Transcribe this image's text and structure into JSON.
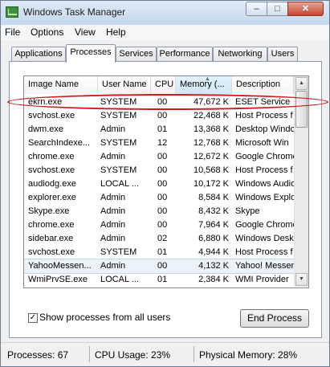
{
  "window": {
    "title": "Windows Task Manager",
    "min": "–",
    "max": "□",
    "close": "✕"
  },
  "menu": [
    {
      "label": "File"
    },
    {
      "label": "Options"
    },
    {
      "label": "View"
    },
    {
      "label": "Help"
    }
  ],
  "tabs": [
    {
      "label": "Applications"
    },
    {
      "label": "Processes"
    },
    {
      "label": "Services"
    },
    {
      "label": "Performance"
    },
    {
      "label": "Networking"
    },
    {
      "label": "Users"
    }
  ],
  "active_tab": "Processes",
  "columns": {
    "name": "Image Name",
    "user": "User Name",
    "cpu": "CPU",
    "memory": "Memory (...",
    "description": "Description",
    "sorted_indicator": "▲"
  },
  "processes": [
    {
      "name": "ekrn.exe",
      "user": "SYSTEM",
      "cpu": "00",
      "mem": "47,672 K",
      "desc": "ESET Service"
    },
    {
      "name": "svchost.exe",
      "user": "SYSTEM",
      "cpu": "00",
      "mem": "22,468 K",
      "desc": "Host Process f"
    },
    {
      "name": "dwm.exe",
      "user": "Admin",
      "cpu": "01",
      "mem": "13,368 K",
      "desc": "Desktop Windo"
    },
    {
      "name": "SearchIndexe...",
      "user": "SYSTEM",
      "cpu": "12",
      "mem": "12,768 K",
      "desc": "Microsoft Win"
    },
    {
      "name": "chrome.exe",
      "user": "Admin",
      "cpu": "00",
      "mem": "12,672 K",
      "desc": "Google Chrome"
    },
    {
      "name": "svchost.exe",
      "user": "SYSTEM",
      "cpu": "00",
      "mem": "10,568 K",
      "desc": "Host Process f"
    },
    {
      "name": "audiodg.exe",
      "user": "LOCAL ...",
      "cpu": "00",
      "mem": "10,172 K",
      "desc": "Windows Audio"
    },
    {
      "name": "explorer.exe",
      "user": "Admin",
      "cpu": "00",
      "mem": "8,584 K",
      "desc": "Windows Explo"
    },
    {
      "name": "Skype.exe",
      "user": "Admin",
      "cpu": "00",
      "mem": "8,432 K",
      "desc": "Skype"
    },
    {
      "name": "chrome.exe",
      "user": "Admin",
      "cpu": "00",
      "mem": "7,964 K",
      "desc": "Google Chrome"
    },
    {
      "name": "sidebar.exe",
      "user": "Admin",
      "cpu": "02",
      "mem": "6,880 K",
      "desc": "Windows Desk"
    },
    {
      "name": "svchost.exe",
      "user": "SYSTEM",
      "cpu": "01",
      "mem": "4,944 K",
      "desc": "Host Process f"
    },
    {
      "name": "YahooMessen...",
      "user": "Admin",
      "cpu": "00",
      "mem": "4,132 K",
      "desc": "Yahoo! Messen"
    },
    {
      "name": "WmiPrvSE.exe",
      "user": "LOCAL ...",
      "cpu": "01",
      "mem": "2,384 K",
      "desc": "WMI Provider"
    }
  ],
  "highlighted_row": 12,
  "show_all": {
    "label": "Show processes from all users",
    "checked": true,
    "mark": "✓"
  },
  "end_process": {
    "label": "End Process"
  },
  "scroll": {
    "up": "▲",
    "down": "▼"
  },
  "status": {
    "processes": "Processes: 67",
    "cpu": "CPU Usage: 23%",
    "memory": "Physical Memory: 28%"
  },
  "colors": {
    "annotation": "#cc1d1d",
    "title_bar": "#c6d7ec",
    "sorted_header": "#cfe7f6"
  }
}
